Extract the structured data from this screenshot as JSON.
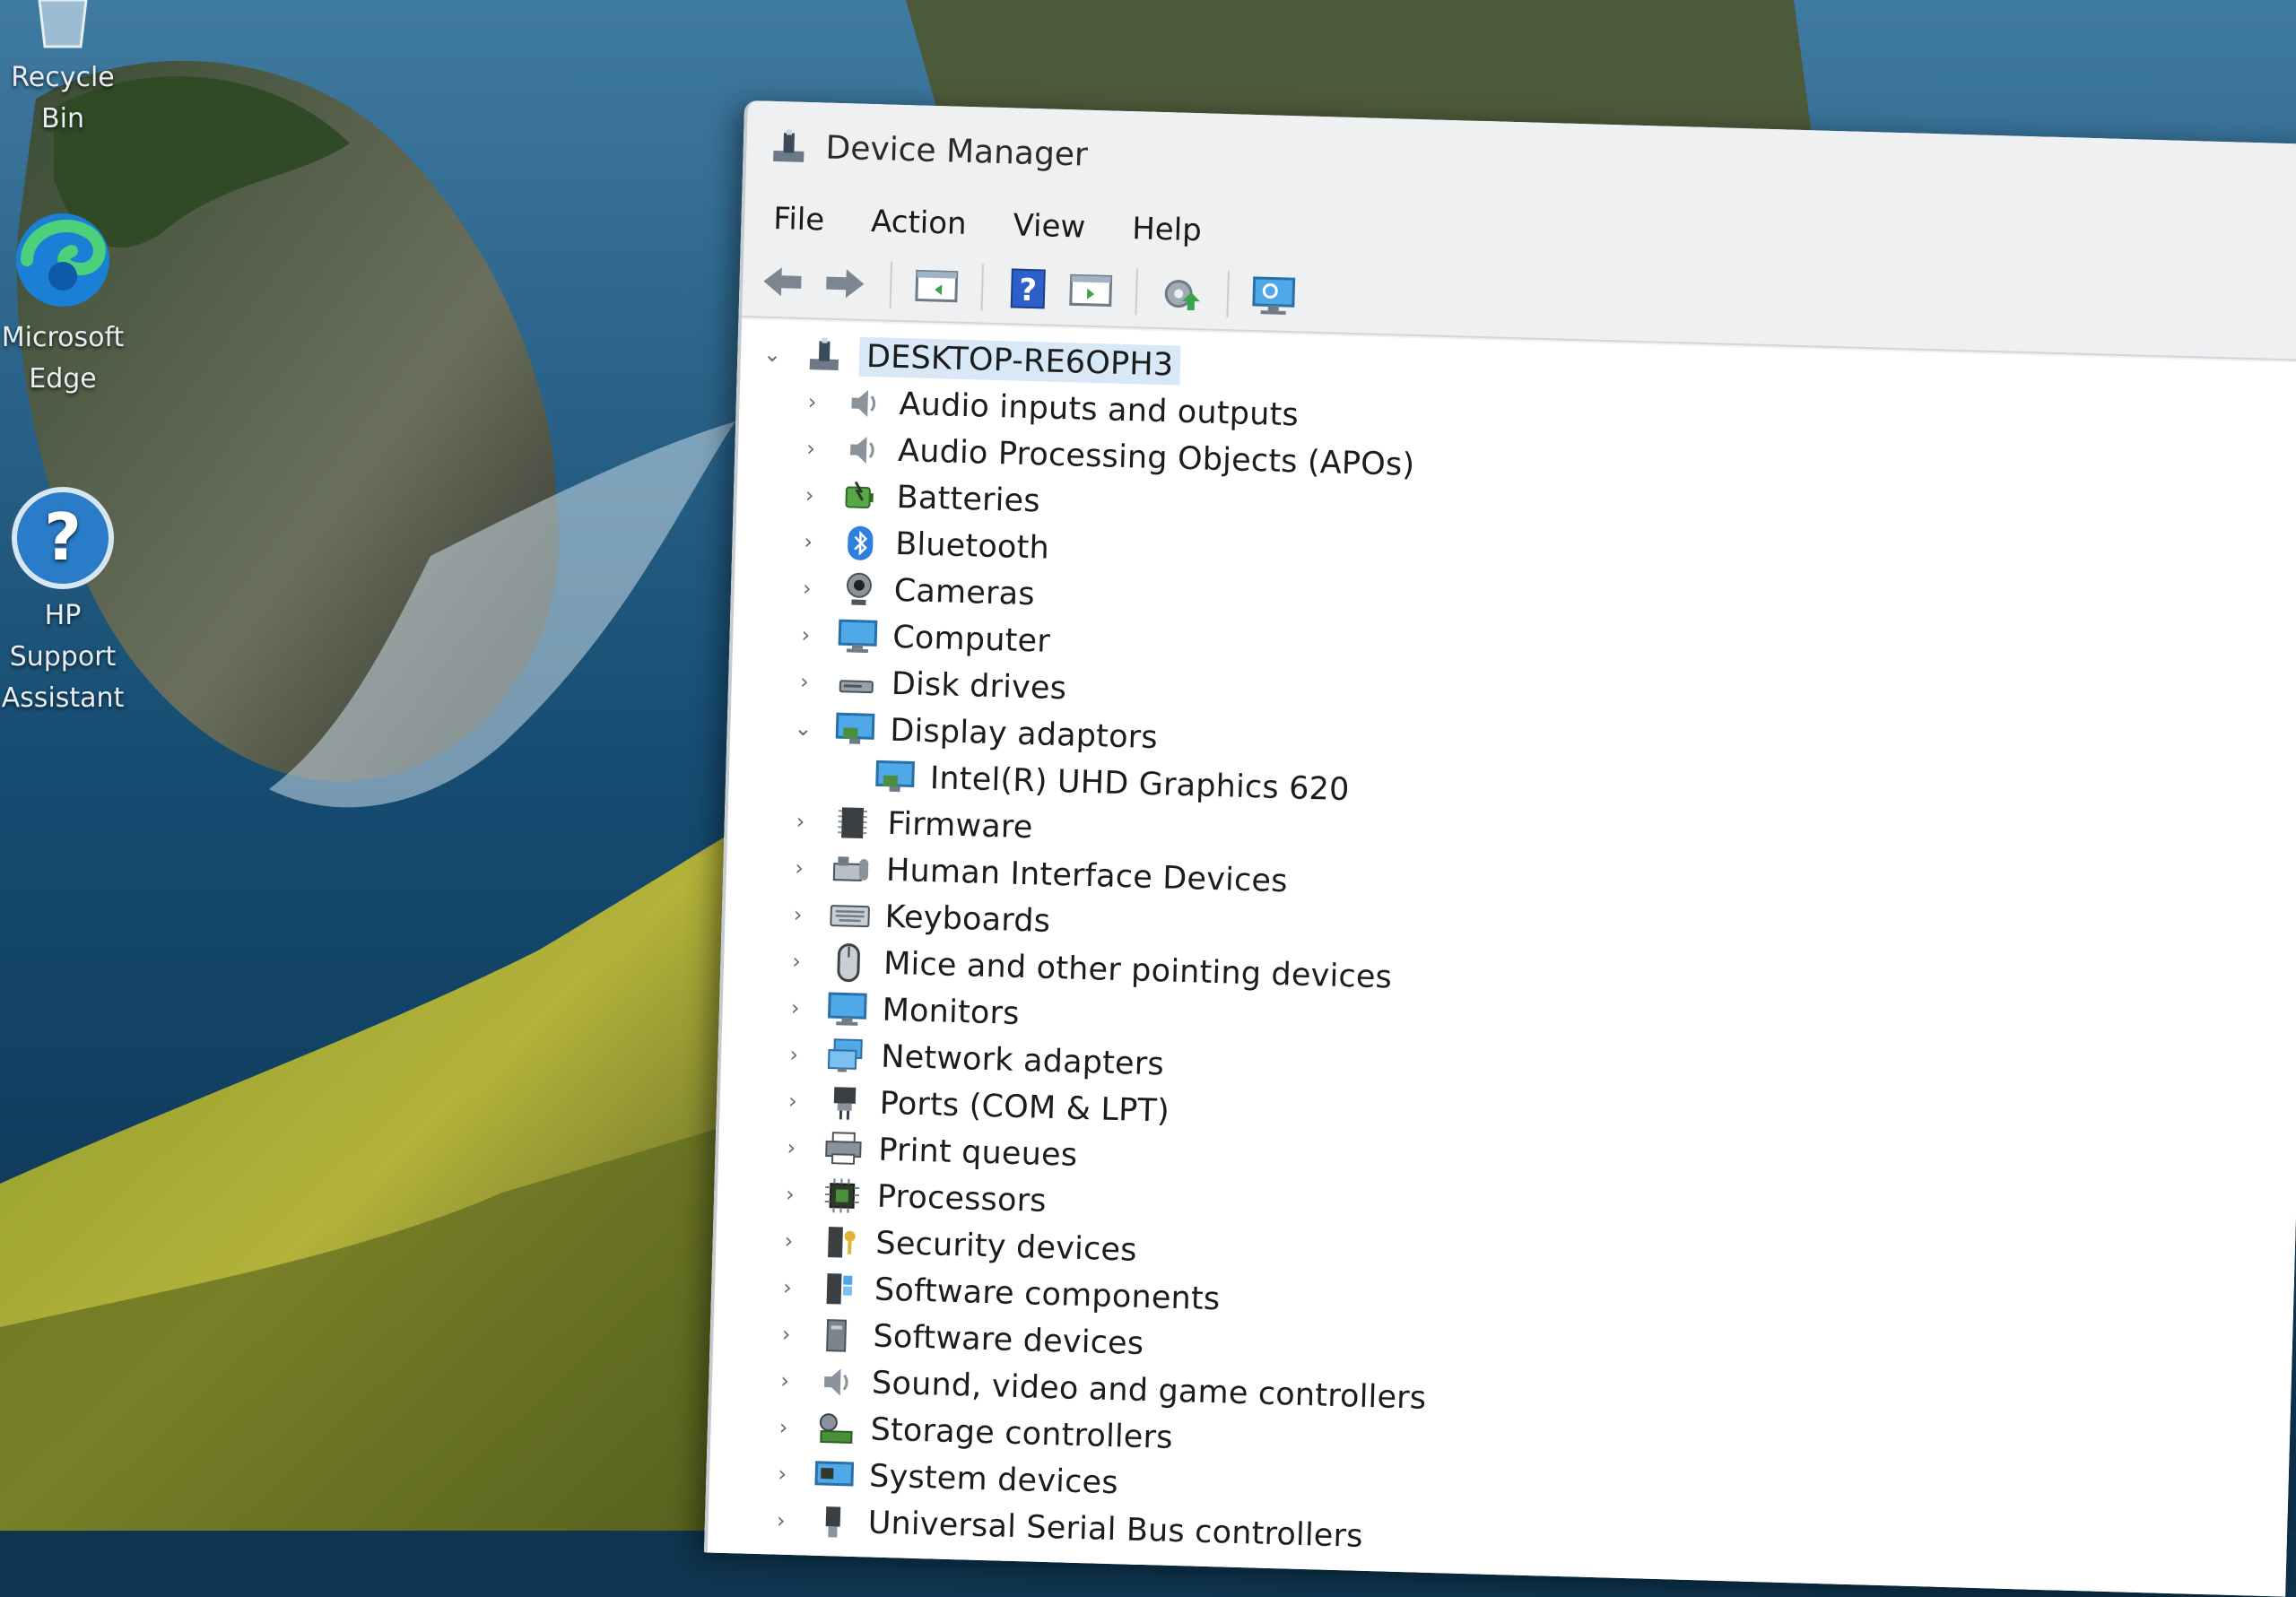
{
  "desktop": {
    "icons": [
      {
        "label": "Recycle Bin",
        "icon": "recycle-bin-icon"
      },
      {
        "label": "Microsoft Edge",
        "icon": "edge-icon"
      },
      {
        "label": "HP Support Assistant",
        "icon": "help-icon"
      }
    ]
  },
  "window": {
    "title": "Device Manager",
    "menu": [
      "File",
      "Action",
      "View",
      "Help"
    ],
    "toolbar": [
      {
        "icon": "back-arrow-icon"
      },
      {
        "icon": "forward-arrow-icon"
      },
      {
        "icon": "show-hide-console-tree-icon"
      },
      {
        "icon": "help-question-icon"
      },
      {
        "icon": "properties-pane-icon"
      },
      {
        "icon": "update-driver-icon"
      },
      {
        "icon": "scan-hardware-monitor-icon"
      }
    ]
  },
  "tree": {
    "root": {
      "label": "DESKTOP-RE6OPH3",
      "expanded": true,
      "icon": "computer-root-icon"
    },
    "items": [
      {
        "label": "Audio inputs and outputs",
        "icon": "speaker-icon",
        "expanded": false
      },
      {
        "label": "Audio Processing Objects (APOs)",
        "icon": "speaker-icon",
        "expanded": false
      },
      {
        "label": "Batteries",
        "icon": "battery-icon",
        "expanded": false
      },
      {
        "label": "Bluetooth",
        "icon": "bluetooth-icon",
        "expanded": false
      },
      {
        "label": "Cameras",
        "icon": "camera-icon",
        "expanded": false
      },
      {
        "label": "Computer",
        "icon": "monitor-icon",
        "expanded": false
      },
      {
        "label": "Disk drives",
        "icon": "disk-drive-icon",
        "expanded": false
      },
      {
        "label": "Display adaptors",
        "icon": "display-adapter-icon",
        "expanded": true,
        "children": [
          {
            "label": "Intel(R) UHD Graphics 620",
            "icon": "display-adapter-icon"
          }
        ]
      },
      {
        "label": "Firmware",
        "icon": "firmware-chip-icon",
        "expanded": false
      },
      {
        "label": "Human Interface Devices",
        "icon": "hid-icon",
        "expanded": false
      },
      {
        "label": "Keyboards",
        "icon": "keyboard-icon",
        "expanded": false
      },
      {
        "label": "Mice and other pointing devices",
        "icon": "mouse-icon",
        "expanded": false
      },
      {
        "label": "Monitors",
        "icon": "monitor-icon",
        "expanded": false
      },
      {
        "label": "Network adapters",
        "icon": "network-adapter-icon",
        "expanded": false
      },
      {
        "label": "Ports (COM & LPT)",
        "icon": "port-icon",
        "expanded": false
      },
      {
        "label": "Print queues",
        "icon": "printer-icon",
        "expanded": false
      },
      {
        "label": "Processors",
        "icon": "processor-icon",
        "expanded": false
      },
      {
        "label": "Security devices",
        "icon": "security-device-icon",
        "expanded": false
      },
      {
        "label": "Software components",
        "icon": "software-component-icon",
        "expanded": false
      },
      {
        "label": "Software devices",
        "icon": "software-device-icon",
        "expanded": false
      },
      {
        "label": "Sound, video and game controllers",
        "icon": "speaker-icon",
        "expanded": false
      },
      {
        "label": "Storage controllers",
        "icon": "storage-controller-icon",
        "expanded": false
      },
      {
        "label": "System devices",
        "icon": "system-device-icon",
        "expanded": false
      },
      {
        "label": "Universal Serial Bus controllers",
        "icon": "usb-icon",
        "expanded": false
      }
    ]
  },
  "colors": {
    "selection": "#d9e8f7",
    "window_bg": "#f0f1f3",
    "tree_bg": "#ffffff",
    "accent_blue": "#1f6fd1"
  }
}
